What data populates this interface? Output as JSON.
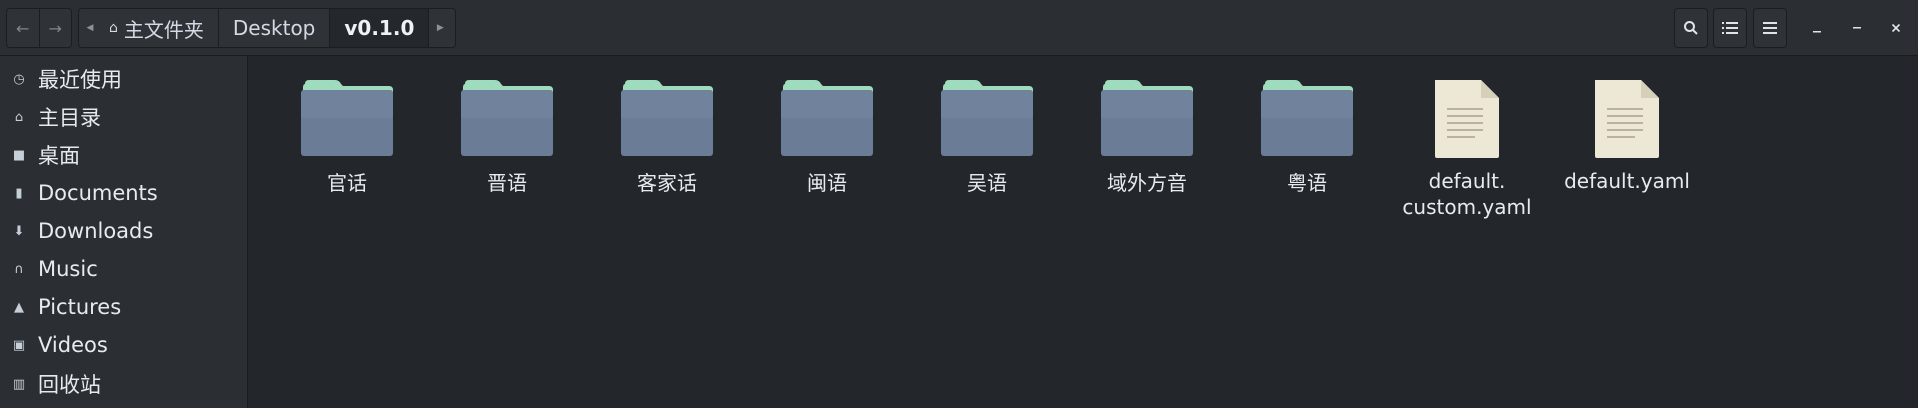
{
  "header": {
    "nav": {
      "back_icon": "arrow-left-icon",
      "forward_icon": "arrow-right-icon"
    },
    "path": {
      "crumbs": [
        {
          "label": "主文件夹",
          "icon": "home-icon"
        },
        {
          "label": "Desktop"
        },
        {
          "label": "v0.1.0",
          "active": true
        }
      ]
    },
    "tools": [
      "search-icon",
      "list-view-icon",
      "menu-icon"
    ],
    "window_controls": [
      "minimize-icon",
      "maximize-icon",
      "close-icon"
    ]
  },
  "sidebar": {
    "items": [
      {
        "label": "最近使用",
        "icon": "clock-icon"
      },
      {
        "label": "主目录",
        "icon": "home-icon"
      },
      {
        "label": "桌面",
        "icon": "desktop-icon"
      },
      {
        "label": "Documents",
        "icon": "document-icon"
      },
      {
        "label": "Downloads",
        "icon": "download-icon"
      },
      {
        "label": "Music",
        "icon": "headphones-icon"
      },
      {
        "label": "Pictures",
        "icon": "picture-icon"
      },
      {
        "label": "Videos",
        "icon": "video-camera-icon"
      },
      {
        "label": "回收站",
        "icon": "trash-icon"
      }
    ]
  },
  "main": {
    "items": [
      {
        "label": "官话",
        "type": "folder"
      },
      {
        "label": "晋语",
        "type": "folder"
      },
      {
        "label": "客家话",
        "type": "folder"
      },
      {
        "label": "闽语",
        "type": "folder"
      },
      {
        "label": "吴语",
        "type": "folder"
      },
      {
        "label": "域外方音",
        "type": "folder"
      },
      {
        "label": "粤语",
        "type": "folder"
      },
      {
        "label": "default.\ncustom.yaml",
        "type": "file"
      },
      {
        "label": "default.yaml",
        "type": "file"
      }
    ]
  },
  "colors": {
    "folder_body": "#6b7d96",
    "folder_tab": "#9fdcbd",
    "file_body": "#ede8d5",
    "background": "#23272c",
    "sidebar": "#2b2f34"
  }
}
